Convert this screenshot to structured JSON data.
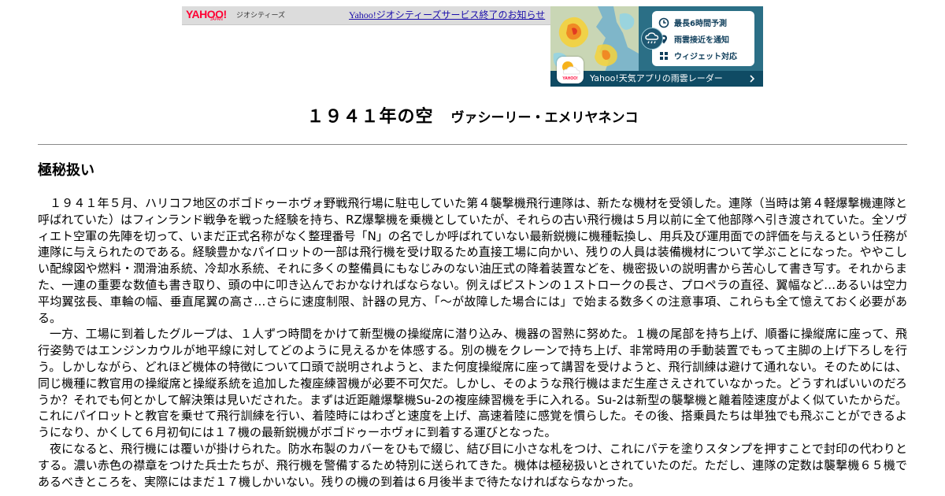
{
  "banner": {
    "logo_text": "YAHOO!",
    "logo_sub": "JAPAN",
    "brand": "ジオシティーズ",
    "notice_link": "Yahoo!ジオシティーズサービス終了のお知らせ"
  },
  "ad": {
    "features": [
      {
        "label": "最長6時間予測",
        "icon": "clock-icon"
      },
      {
        "label": "雨雲接近を通知",
        "icon": "location-pin-icon"
      },
      {
        "label": "ウィジェット対応",
        "icon": "widget-grid-icon"
      }
    ],
    "app_icon_text": "YAHOO!",
    "bottom_label": "Yahoo!天気アプリの雨雲レーダー",
    "colors": {
      "background": "#2b6f86",
      "bottom_bar": "#0f4b64",
      "feature_text": "#0f3e5b"
    }
  },
  "article": {
    "title": "１９４１年の空",
    "author": "ヴァシーリー・エメリヤネンコ",
    "section_heading": "極秘扱い",
    "paragraphs": [
      "１９４１年５月、ハリコフ地区のボゴドゥーホヴォ野戦飛行場に駐屯していた第４襲撃機飛行連隊は、新たな機材を受領した。連隊（当時は第４軽爆撃機連隊と呼ばれていた）はフィンランド戦争を戦った経験を持ち、RZ爆撃機を乗機としていたが、それらの古い飛行機は５月以前に全て他部隊へ引き渡されていた。全ソヴィエト空軍の先陣を切って、いまだ正式名称がなく整理番号「N」の名でしか呼ばれていない最新鋭機に機種転換し、用兵及び運用面での評価を与えるという任務が連隊に与えられたのである。経験豊かなパイロットの一部は飛行機を受け取るため直接工場に向かい、残りの人員は装備機材について学ぶことになった。ややこしい配線図や燃料・潤滑油系統、冷却水系統、それに多くの整備員にもなじみのない油圧式の降着装置などを、機密扱いの説明書から苦心して書き写す。それからまた、一連の重要な数値も書き取り、頭の中に叩き込んでおかなければならない。例えばピストンの１ストロークの長さ、プロペラの直径、翼幅など…あるいは空力平均翼弦長、車輪の幅、垂直尾翼の高さ…さらに速度制限、計器の見方、「～が故障した場合には」で始まる数多くの注意事項、これらも全て憶えておく必要がある。",
      "一方、工場に到着したグループは、１人ずつ時間をかけて新型機の操縦席に潜り込み、機器の習熟に努めた。１機の尾部を持ち上げ、順番に操縦席に座って、飛行姿勢ではエンジンカウルが地平線に対してどのように見えるかを体感する。別の機をクレーンで持ち上げ、非常時用の手動装置でもって主脚の上げ下ろしを行う。しかしながら、どれほど機体の特徴について口頭で説明されようと、また何度操縦席に座って講習を受けようと、飛行訓練は避けて通れない。そのためには、同じ機種に教官用の操縦席と操縦系統を追加した複座練習機が必要不可欠だ。しかし、そのような飛行機はまだ生産さえされていなかった。どうすればいいのだろうか？それでも何とかして解決策は見いだされた。まずは近距離爆撃機Su-2の複座練習機を手に入れる。Su-2は新型の襲撃機と離着陸速度がよく似ていたからだ。これにパイロットと教官を乗せて飛行訓練を行い、着陸時にはわざと速度を上げ、高速着陸に感覚を慣らした。その後、搭乗員たちは単独でも飛ぶことができるようになり、かくして６月初旬には１７機の最新鋭機がボゴドゥーホヴォに到着する運びとなった。",
      "夜になると、飛行機には覆いが掛けられた。防水布製のカバーをひもで綴じ、結び目に小さな札をつけ、これにパテを塗りスタンプを押すことで封印の代わりとする。濃い赤色の襟章をつけた兵士たちが、飛行機を警備するため特別に送られてきた。機体は極秘扱いとされていたのだ。ただし、連隊の定数は襲撃機６５機であるべきところを、実際にはまだ１７機しかいない。残りの機の到着は６月後半まで待たなければならなかった。"
    ]
  }
}
